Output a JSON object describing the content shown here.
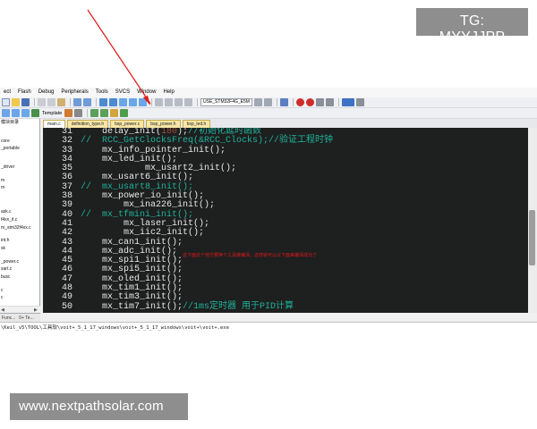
{
  "watermarks": {
    "top": "TG: MYYJJPP",
    "bottom": "www.nextpathsolar.com"
  },
  "menubar": [
    "ect",
    "Flash",
    "Debug",
    "Peripherals",
    "Tools",
    "SVCS",
    "Window",
    "Help"
  ],
  "toolbar": {
    "target": "USE_STM32F4G_E5M",
    "template_label": "Template"
  },
  "file_tabs": [
    {
      "label": "main.c",
      "active": true
    },
    {
      "label": "definition_type.h",
      "active": false
    },
    {
      "label": "bsp_power.c",
      "active": false
    },
    {
      "label": "bsp_power.h",
      "active": false
    },
    {
      "label": "bsp_led.h",
      "active": false
    }
  ],
  "project_panel": {
    "items": [
      "模块目录",
      "",
      "",
      "core",
      "_portable",
      "",
      "",
      "_driver",
      "",
      "m",
      "m",
      "",
      "",
      "",
      "ask.c",
      "f4xx_it.c",
      "m_stm32f4xx.c",
      "",
      "int.h",
      "sk",
      "",
      "_power.c",
      "sart.c",
      "busc",
      "",
      "c",
      "c"
    ],
    "tabs": [
      "Func...",
      "0+ Te..."
    ]
  },
  "editor": {
    "lines": [
      {
        "no": "31",
        "parts": [
          {
            "t": "    delay_init("
          },
          {
            "t": "180",
            "c": "num"
          },
          {
            "t": ");"
          },
          {
            "t": "//初始化延时函数",
            "c": "cm"
          }
        ]
      },
      {
        "no": "32",
        "parts": [
          {
            "t": "//  RCC_GetClocksFreq(&RCC_Clocks);//验证工程时钟",
            "c": "cm"
          }
        ]
      },
      {
        "no": "33",
        "parts": [
          {
            "t": "    mx_info_pointer_init();"
          }
        ]
      },
      {
        "no": "34",
        "parts": [
          {
            "t": "    mx_led_init();"
          }
        ]
      },
      {
        "no": "35",
        "parts": [
          {
            "t": "            mx_usart2_init();"
          }
        ]
      },
      {
        "no": "36",
        "parts": [
          {
            "t": "    mx_usart6_init();"
          }
        ]
      },
      {
        "no": "37",
        "parts": [
          {
            "t": "//  mx_usart8_init();",
            "c": "cm"
          }
        ]
      },
      {
        "no": "38",
        "parts": [
          {
            "t": "    mx_power_io_init();"
          }
        ]
      },
      {
        "no": "39",
        "parts": [
          {
            "t": "        mx_ina226_init();"
          }
        ]
      },
      {
        "no": "40",
        "parts": [
          {
            "t": "//  mx_tfmini_init();",
            "c": "cm"
          }
        ]
      },
      {
        "no": "41",
        "parts": [
          {
            "t": "        mx_laser_init();"
          }
        ]
      },
      {
        "no": "42",
        "parts": [
          {
            "t": "        mx_iic2_init();"
          }
        ]
      },
      {
        "no": "43",
        "parts": [
          {
            "t": "    mx_can1_init();"
          }
        ]
      },
      {
        "no": "44",
        "parts": [
          {
            "t": "    mx_adc_init();"
          }
        ]
      },
      {
        "no": "45",
        "parts": [
          {
            "t": "    mx_spi1_init();"
          }
        ]
      },
      {
        "no": "46",
        "parts": [
          {
            "t": "    mx_spi5_init();"
          }
        ]
      },
      {
        "no": "47",
        "parts": [
          {
            "t": "    mx_oled_init();"
          }
        ]
      },
      {
        "no": "48",
        "parts": [
          {
            "t": "    mx_tim1_init();"
          }
        ]
      },
      {
        "no": "49",
        "parts": [
          {
            "t": "    mx_tim3_init();"
          }
        ]
      },
      {
        "no": "50",
        "parts": [
          {
            "t": "    mx_tim7_init();"
          },
          {
            "t": "//1ms定时器 用于PID计算",
            "c": "cm"
          }
        ]
      }
    ],
    "annotation": "这下面这个地方要换个工具链编译，这样就可以以下面来编译成功了"
  },
  "build_output": "\\Keil_v5\\TOOL\\工具软\\voit+_5_1_17_windows\\voit+_5_1_17_windows\\voit+\\voit+.exe",
  "colors": {
    "editor_bg": "#1e1f1f",
    "comment": "#1fb39b",
    "number": "#9a4f3d",
    "annotation": "#e01a1a"
  }
}
